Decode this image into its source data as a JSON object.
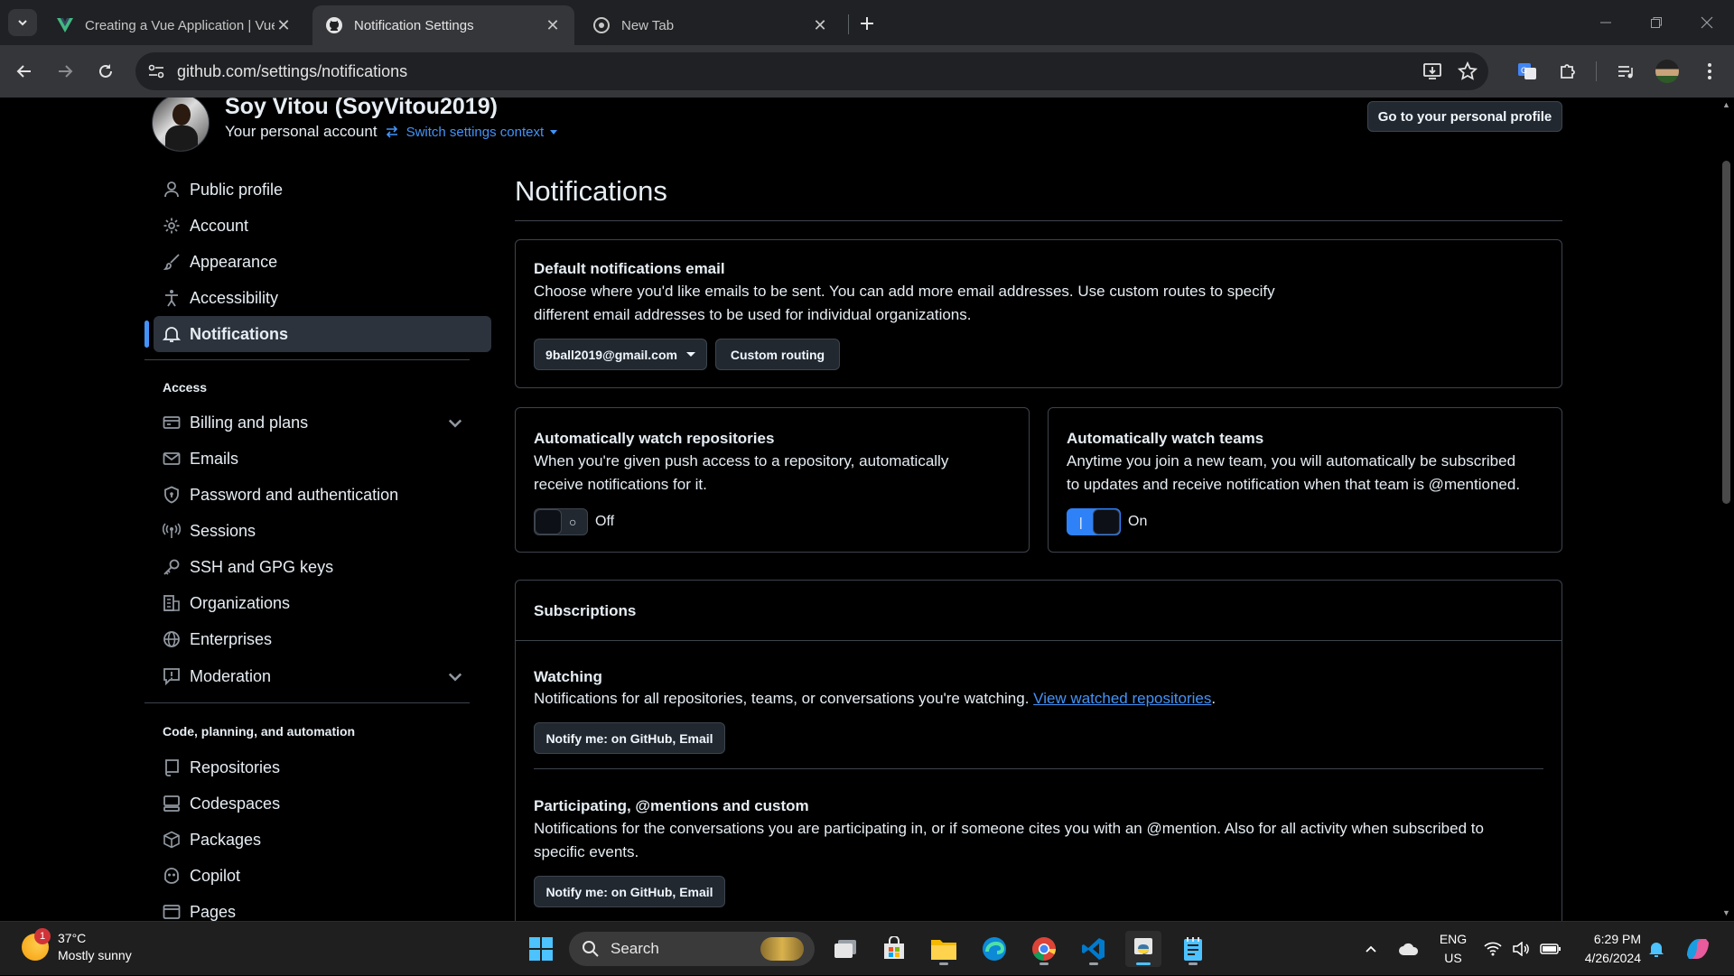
{
  "browser": {
    "tabs": [
      {
        "title": "Creating a Vue Application | Vue.js",
        "active": false
      },
      {
        "title": "Notification Settings",
        "active": true
      },
      {
        "title": "New Tab",
        "active": false
      }
    ],
    "url": "github.com/settings/notifications"
  },
  "header": {
    "user_name": "Soy Vitou (SoyVitou2019)",
    "account_label": "Your personal account",
    "switch_context": "Switch settings context",
    "profile_button": "Go to your personal profile"
  },
  "sidebar": {
    "items": [
      {
        "label": "Public profile",
        "icon": "person-icon"
      },
      {
        "label": "Account",
        "icon": "gear-icon"
      },
      {
        "label": "Appearance",
        "icon": "paintbrush-icon"
      },
      {
        "label": "Accessibility",
        "icon": "accessibility-icon"
      },
      {
        "label": "Notifications",
        "icon": "bell-icon",
        "active": true
      }
    ],
    "access_heading": "Access",
    "access_items": [
      {
        "label": "Billing and plans",
        "icon": "credit-card-icon",
        "expandable": true
      },
      {
        "label": "Emails",
        "icon": "mail-icon"
      },
      {
        "label": "Password and authentication",
        "icon": "shield-lock-icon"
      },
      {
        "label": "Sessions",
        "icon": "broadcast-icon"
      },
      {
        "label": "SSH and GPG keys",
        "icon": "key-icon"
      },
      {
        "label": "Organizations",
        "icon": "organization-icon"
      },
      {
        "label": "Enterprises",
        "icon": "globe-icon"
      },
      {
        "label": "Moderation",
        "icon": "report-icon",
        "expandable": true
      }
    ],
    "code_heading": "Code, planning, and automation",
    "code_items": [
      {
        "label": "Repositories",
        "icon": "repo-icon"
      },
      {
        "label": "Codespaces",
        "icon": "codespaces-icon"
      },
      {
        "label": "Packages",
        "icon": "package-icon"
      },
      {
        "label": "Copilot",
        "icon": "copilot-icon"
      },
      {
        "label": "Pages",
        "icon": "browser-icon"
      }
    ]
  },
  "main": {
    "title": "Notifications",
    "default_email": {
      "heading": "Default notifications email",
      "line1": "Choose where you'd like emails to be sent. You can add more email addresses. Use custom routes to specify",
      "line2": "different email addresses to be used for individual organizations.",
      "email_select": "9ball2019@gmail.com",
      "custom_routing": "Custom routing"
    },
    "watch_repos": {
      "heading": "Automatically watch repositories",
      "line1": "When you're given push access to a repository, automatically",
      "line2": "receive notifications for it.",
      "state": "Off"
    },
    "watch_teams": {
      "heading": "Automatically watch teams",
      "line1": "Anytime you join a new team, you will automatically be subscribed",
      "line2": "to updates and receive notification when that team is @mentioned.",
      "state": "On"
    },
    "subscriptions": {
      "heading": "Subscriptions",
      "watching_heading": "Watching",
      "watching_text": "Notifications for all repositories, teams, or conversations you're watching.",
      "watching_link": "View watched repositories",
      "watching_link_suffix": ".",
      "watching_button": "Notify me: on GitHub, Email",
      "participating_heading": "Participating, @mentions and custom",
      "participating_line1": "Notifications for the conversations you are participating in, or if someone cites you with an @mention. Also for all activity when subscribed to",
      "participating_line2": "specific events.",
      "participating_button": "Notify me: on GitHub, Email"
    }
  },
  "taskbar": {
    "weather_temp": "37°C",
    "weather_desc": "Mostly sunny",
    "weather_badge": "1",
    "search_placeholder": "Search",
    "lang_line1": "ENG",
    "lang_line2": "US",
    "time": "6:29 PM",
    "date": "4/26/2024"
  },
  "colors": {
    "accent": "#4493f8",
    "toggle_on": "#2f81f7",
    "background": "#000000"
  }
}
